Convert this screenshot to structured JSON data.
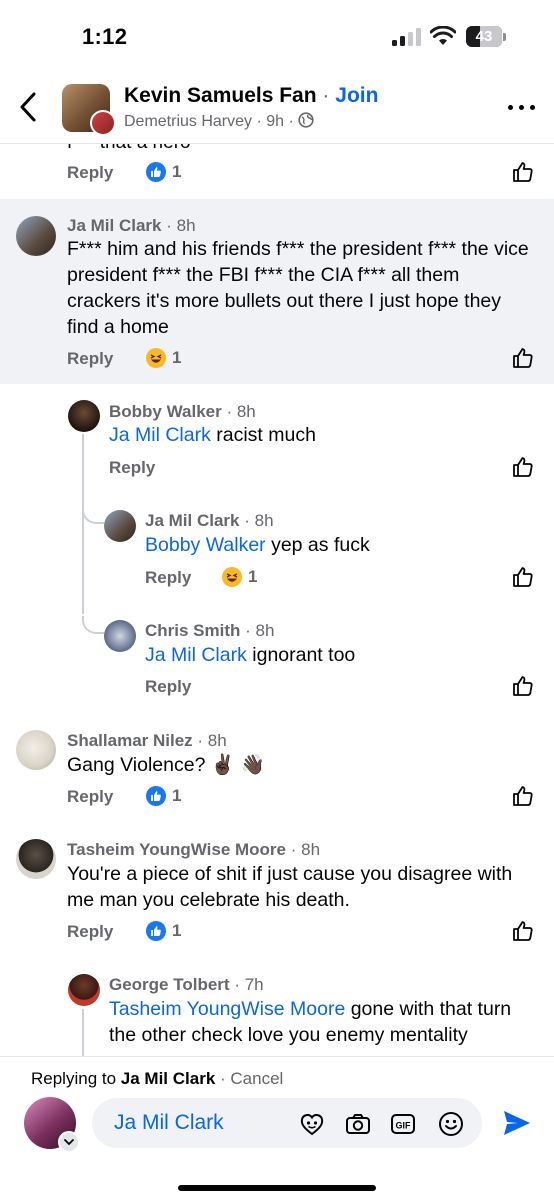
{
  "status": {
    "time": "1:12",
    "battery": "43"
  },
  "header": {
    "group_name": "Kevin Samuels Fan",
    "separator": "·",
    "join_label": "Join",
    "author": "Demetrius Harvey",
    "age": "9h",
    "dot": "·"
  },
  "cut_top": {
    "text": "f*** that a hero",
    "reply": "Reply",
    "like_count": "1"
  },
  "comments": [
    {
      "name": "Ja Mil Clark",
      "time": "· 8h",
      "text": "F*** him and his friends f*** the president f*** the vice president f*** the FBI f*** the CIA f*** all them crackers it's more bullets out there I just hope they find a home",
      "reply": "Reply",
      "reaction_count": "1"
    },
    {
      "name": "Bobby Walker",
      "time": "· 8h",
      "mention": "Ja Mil Clark",
      "text": " racist much",
      "reply": "Reply"
    },
    {
      "name": "Ja Mil Clark",
      "time": "· 8h",
      "mention": "Bobby Walker",
      "text": " yep as fuck",
      "reply": "Reply",
      "reaction_count": "1"
    },
    {
      "name": "Chris Smith",
      "time": "· 8h",
      "mention": "Ja Mil Clark",
      "text": " ignorant too",
      "reply": "Reply"
    },
    {
      "name": "Shallamar Nilez",
      "time": "· 8h",
      "text": "Gang Violence? ✌🏿 👋🏿",
      "reply": "Reply",
      "reaction_count": "1"
    },
    {
      "name": "Tasheim YoungWise Moore",
      "time": "· 8h",
      "text": "You're a piece of shit if just cause you disagree with me man you celebrate his death.",
      "reply": "Reply",
      "reaction_count": "1"
    },
    {
      "name": "George Tolbert",
      "time": "· 7h",
      "mention": "Tasheim YoungWise Moore",
      "text": " gone with that turn the other check love you enemy mentality"
    }
  ],
  "composer": {
    "replying_prefix": "Replying to ",
    "replying_to": "Ja Mil Clark",
    "cancel": "· Cancel",
    "input_value": "Ja Mil Clark",
    "icons": [
      "avatar-sticker-icon",
      "camera-icon",
      "gif-icon",
      "emoji-icon",
      "send-icon"
    ]
  },
  "colors": {
    "accent": "#0a66e8",
    "like_blue": "#1877f2",
    "muted": "#65676b",
    "highlight_bg": "#f0f2f5"
  }
}
